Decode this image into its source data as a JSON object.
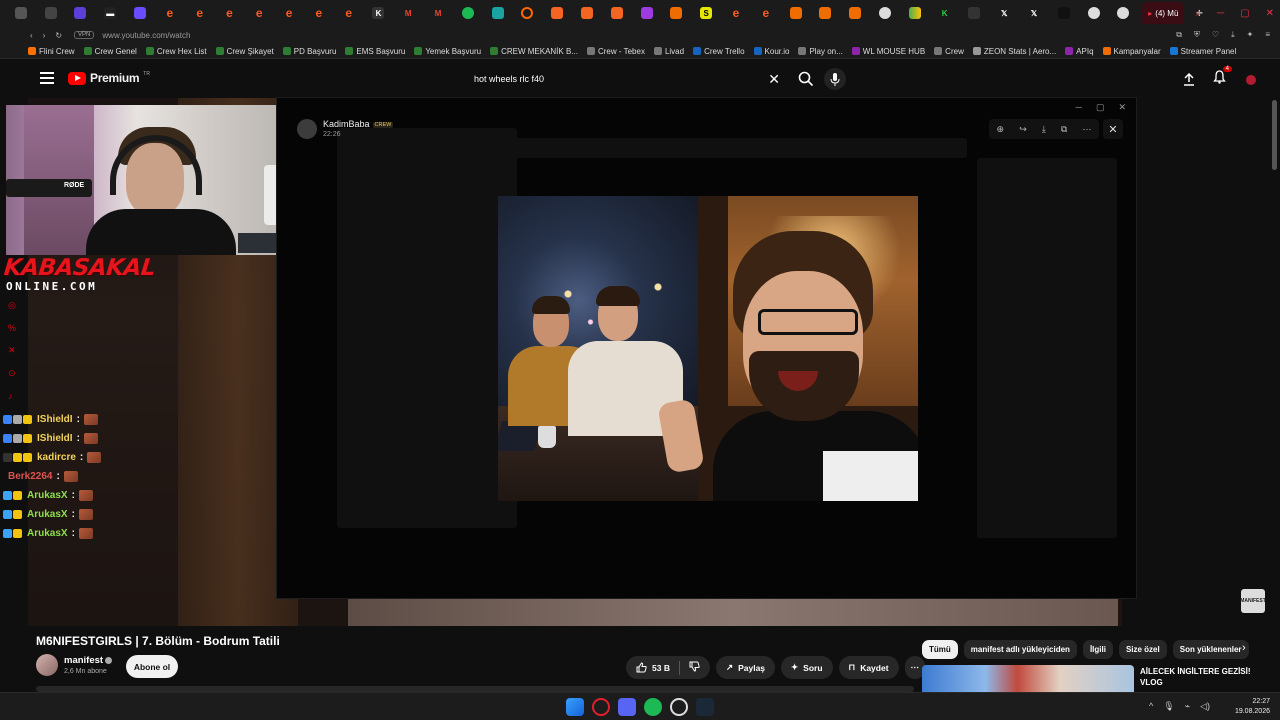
{
  "browser": {
    "active_tab_label": "(4) Mü",
    "url": "www.youtube.com/watch",
    "vpn_label": "VPN",
    "bookmarks": [
      "Flini Crew",
      "Crew Genel",
      "Crew Hex List",
      "Crew Şikayet",
      "PD Başvuru",
      "EMS Başvuru",
      "Yemek Başvuru",
      "CREW MEKANİK B...",
      "Crew - Tebex",
      "Livad",
      "Crew Trello",
      "Kour.io",
      "Play on...",
      "WL MOUSE HUB",
      "Crew",
      "ZEON Stats | Aero...",
      "APIq",
      "Kampanyalar",
      "Streamer Panel"
    ]
  },
  "youtube": {
    "logo_text": "Premium",
    "logo_sup": "TR",
    "search_query": "hot wheels rlc f40",
    "notif_count": "4"
  },
  "overlay": {
    "brand_line1": "KABASAKAL",
    "brand_line2": "ONLINE.COM",
    "webcam_mic_label": "RØDE"
  },
  "chat": [
    {
      "name": "IShieldI",
      "color": "#f2d25a"
    },
    {
      "name": "IShieldI",
      "color": "#f2d25a"
    },
    {
      "name": "kadircre",
      "color": "#f2d25a"
    },
    {
      "name": "Berk2264",
      "color": "#e0524f"
    },
    {
      "name": "ArukasX",
      "color": "#8fe04a"
    },
    {
      "name": "ArukasX",
      "color": "#8fe04a"
    },
    {
      "name": "ArukasX",
      "color": "#8fe04a"
    }
  ],
  "modal": {
    "poster_name": "KadimBaba",
    "poster_tag": "CREW",
    "poster_time": "22:26"
  },
  "video": {
    "title": "M6NIFESTGIRLS | 7. Bölüm - Bodrum Tatili",
    "channel": "manifest",
    "subs": "2,6 Mn abone",
    "subscribe": "Abone ol",
    "likes": "53 B",
    "share": "Paylaş",
    "ask": "Soru",
    "save": "Kaydet",
    "corner_logo": "MANIFEST"
  },
  "chips": [
    "Tümü",
    "manifest adlı yükleyiciden",
    "İlgili",
    "Size özel",
    "Son yüklenenler"
  ],
  "recommendation": {
    "title": "AİLECEK İNGİLTERE GEZİSİ! VLOG"
  },
  "taskbar": {
    "time": "22:27",
    "date": "19.08.2026"
  },
  "colors": {
    "accent_red": "#ff0000",
    "brand_red": "#e8141b",
    "chat_gold": "#f2d25a",
    "chat_green": "#8fe04a"
  }
}
